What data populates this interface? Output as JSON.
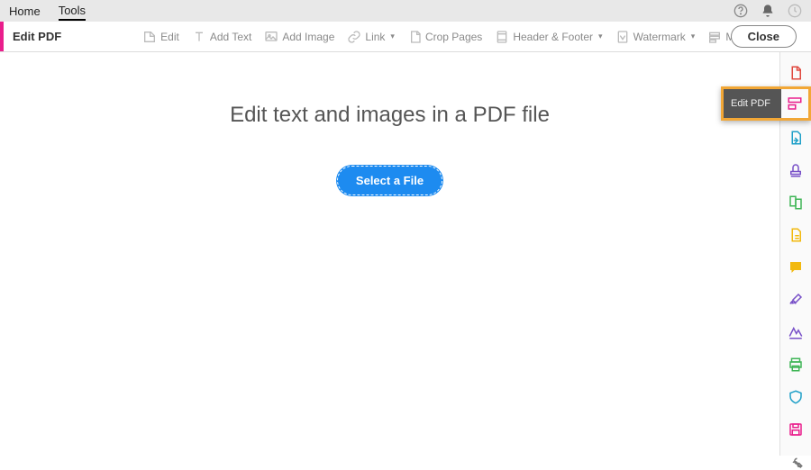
{
  "tabs": {
    "home": "Home",
    "tools": "Tools"
  },
  "toolbar": {
    "title": "Edit PDF",
    "edit": "Edit",
    "add_text": "Add Text",
    "add_image": "Add Image",
    "link": "Link",
    "crop": "Crop Pages",
    "header_footer": "Header & Footer",
    "watermark": "Watermark",
    "more": "More",
    "close": "Close"
  },
  "main": {
    "heading": "Edit text and images in a PDF file",
    "select_btn": "Select a File"
  },
  "tooltip": {
    "label": "Edit PDF"
  },
  "colors": {
    "accent_pink": "#e91e8c",
    "button_blue": "#1d8bf0",
    "highlight_orange": "#f2a736"
  }
}
